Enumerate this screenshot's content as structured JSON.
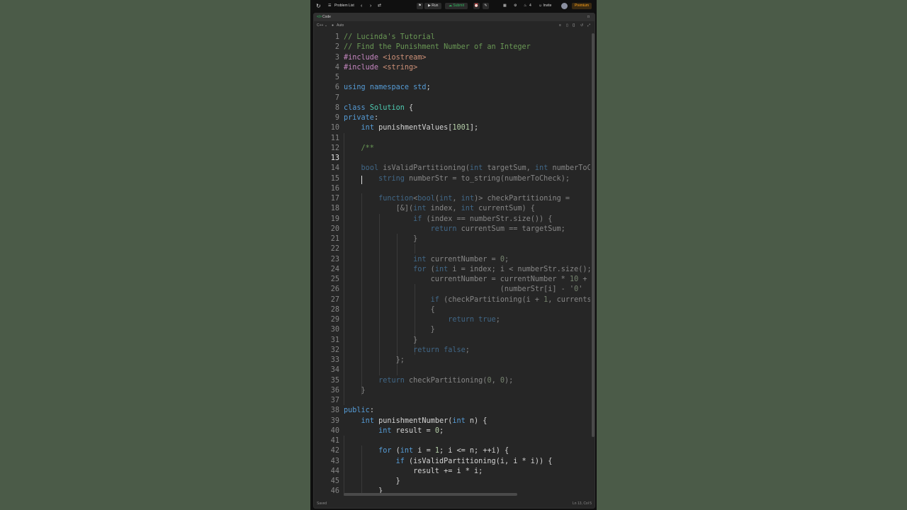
{
  "toolbar": {
    "problem_list": "Problem List",
    "run_label": "Run",
    "submit_label": "Submit",
    "fire_count": "4",
    "invite_label": "Invite",
    "premium_label": "Premium"
  },
  "panel": {
    "tab_label": "Code",
    "language": "C++",
    "mode": "Auto"
  },
  "status": {
    "left": "Saved",
    "right": "Ln 13, Col 5"
  },
  "colors": {
    "accent": "#ffa116",
    "submit": "#2fb55d",
    "comment": "#6a9955",
    "keyword": "#569cd6"
  },
  "editor": {
    "active_line": 13,
    "lines": [
      "// Lucinda's Tutorial",
      "// Find the Punishment Number of an Integer",
      "#include <iostream>",
      "#include <string>",
      "",
      "using namespace std;",
      "",
      "class Solution {",
      "private:",
      "    int punishmentValues[1001];",
      "",
      "    /**",
      "    ",
      "    bool isValidPartitioning(int targetSum, int numberToC",
      "        string numberStr = to_string(numberToCheck);",
      "",
      "        function<bool(int, int)> checkPartitioning =",
      "            [&](int index, int currentSum) {",
      "                if (index == numberStr.size()) {",
      "                    return currentSum == targetSum;",
      "                }",
      "",
      "                int currentNumber = 0;",
      "                for (int i = index; i < numberStr.size();",
      "                    currentNumber = currentNumber * 10 +",
      "                                    (numberStr[i] - '0'",
      "                    if (checkPartitioning(i + 1, currents",
      "                    {",
      "                        return true;",
      "                    }",
      "                }",
      "                return false;",
      "            };",
      "",
      "        return checkPartitioning(0, 0);",
      "    }",
      "",
      "public:",
      "    int punishmentNumber(int n) {",
      "        int result = 0;",
      "",
      "        for (int i = 1; i <= n; ++i) {",
      "            if (isValidPartitioning(i, i * i)) {",
      "                result += i * i;",
      "            }",
      "        }"
    ]
  }
}
